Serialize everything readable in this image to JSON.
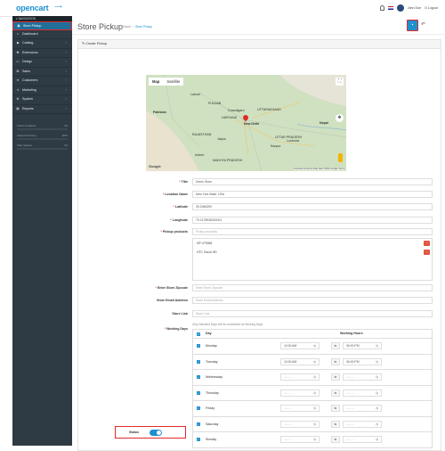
{
  "header": {
    "logo": "opencart",
    "user_name": "John Doe",
    "logout": "Logout"
  },
  "sidebar": {
    "heading": "NAVIGATION",
    "items": [
      {
        "label": "Store Pickup",
        "icon": "store-icon",
        "active": true
      },
      {
        "label": "Dashboard",
        "icon": "dashboard-icon"
      },
      {
        "label": "Catalog",
        "icon": "tag-icon"
      },
      {
        "label": "Extensions",
        "icon": "puzzle-icon"
      },
      {
        "label": "Design",
        "icon": "monitor-icon"
      },
      {
        "label": "Sales",
        "icon": "cart-icon"
      },
      {
        "label": "Customers",
        "icon": "user-icon"
      },
      {
        "label": "Marketing",
        "icon": "share-icon"
      },
      {
        "label": "System",
        "icon": "gear-icon"
      },
      {
        "label": "Reports",
        "icon": "chart-icon"
      }
    ],
    "stats": [
      {
        "label": "Orders Completed",
        "value": "0%"
      },
      {
        "label": "Orders Processing",
        "value": "100%"
      },
      {
        "label": "Other Statuses",
        "value": "0%"
      }
    ]
  },
  "page": {
    "title": "Store Pickup",
    "breadcrumb_home": "Home",
    "breadcrumb_current": "Store Pickup",
    "panel_title": "Create Pickup"
  },
  "map": {
    "label": "MAP",
    "tab_map": "Map",
    "tab_satellite": "Satellite",
    "places": [
      "Pakistan",
      "PUNJAB",
      "Chandigarh",
      "HARYANA",
      "UTTARAKHAND",
      "New Delhi",
      "RAJASTHAN",
      "UTTAR PRADESH",
      "Nepal",
      "Kanpur",
      "Lucknow",
      "MADHYA PRADESH",
      "Indore",
      "Jaipur",
      "Lahore"
    ],
    "footer": "Keyboard shortcuts  Map data ©2022 Google  Terms",
    "brand": "Google"
  },
  "form": {
    "title_label": "Title",
    "title_value": "Demo Store",
    "location_label": "Location Name",
    "location_value": "New York State, USA",
    "latitude_label": "Latitude",
    "latitude_value": "25.2066390",
    "longitude_label": "Longitude",
    "longitude_value": "75.2178936000001",
    "products_label": "Pickup products",
    "products_placeholder": "Pickup products",
    "products": [
      "HP LP3065",
      "HTC Touch HD"
    ],
    "zipcode_label": "Enter Store Zipcode",
    "zipcode_placeholder": "Enter Store Zipcode",
    "email_label": "Store Email Address",
    "email_placeholder": "Store Email Address",
    "link_label": "Store Link",
    "link_placeholder": "Store Link",
    "working_days_label": "Working Days",
    "working_days_note": "Only Selected Days will be considered as Working Days",
    "day_header": "Day",
    "hours_header": "Working Hours",
    "to_label": "to",
    "days": [
      {
        "day": "Monday",
        "from": "10:00 AM",
        "to": "06:00 PM"
      },
      {
        "day": "Tuesday",
        "from": "10:00 AM",
        "to": "06:00 PM"
      },
      {
        "day": "Wednesday",
        "from": "--:-- --",
        "to": "--:-- --"
      },
      {
        "day": "Thursday",
        "from": "--:-- --",
        "to": "--:-- --"
      },
      {
        "day": "Friday",
        "from": "--:-- --",
        "to": "--:-- --"
      },
      {
        "day": "Saturday",
        "from": "--:-- --",
        "to": "--:-- --"
      },
      {
        "day": "Sunday",
        "from": "--:-- --",
        "to": "--:-- --"
      }
    ],
    "status_label": "Status",
    "status_on": true
  }
}
